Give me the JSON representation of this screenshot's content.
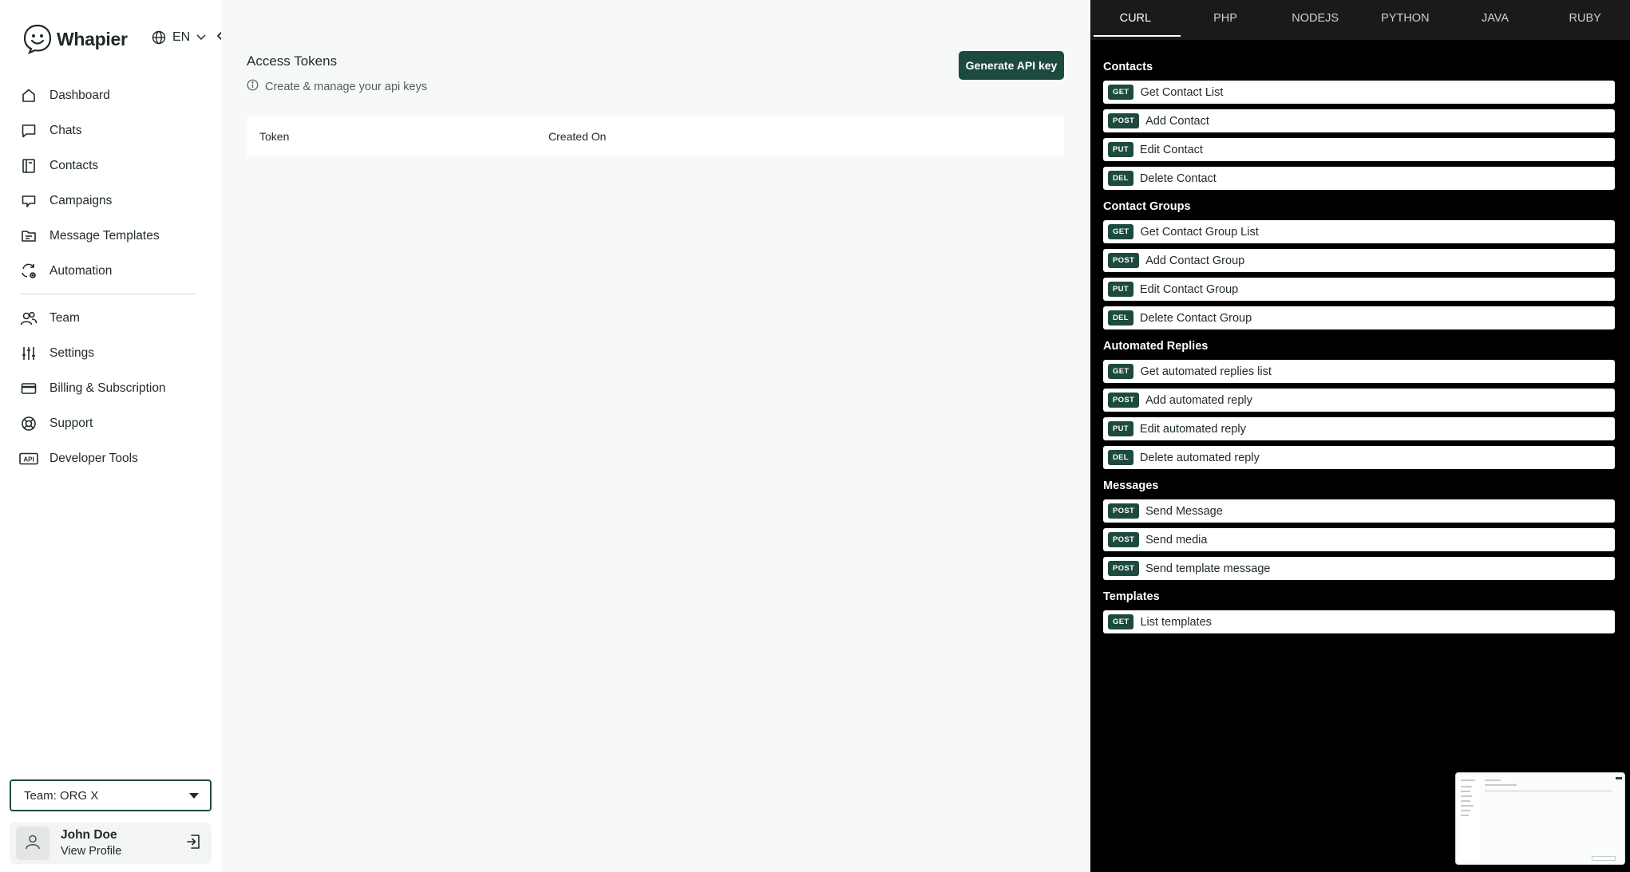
{
  "app": {
    "brand": "Whapier",
    "language": "EN"
  },
  "sidebar": {
    "items": [
      {
        "label": "Dashboard",
        "icon": "home-icon"
      },
      {
        "label": "Chats",
        "icon": "chat-bubble-icon"
      },
      {
        "label": "Contacts",
        "icon": "contacts-book-icon"
      },
      {
        "label": "Campaigns",
        "icon": "megaphone-icon"
      },
      {
        "label": "Message Templates",
        "icon": "folder-template-icon"
      },
      {
        "label": "Automation",
        "icon": "automation-icon"
      },
      {
        "label": "Team",
        "icon": "team-icon"
      },
      {
        "label": "Settings",
        "icon": "sliders-icon"
      },
      {
        "label": "Billing & Subscription",
        "icon": "credit-card-icon"
      },
      {
        "label": "Support",
        "icon": "lifebuoy-icon"
      },
      {
        "label": "Developer Tools",
        "icon": "api-icon"
      }
    ],
    "team_select": "Team: ORG X",
    "profile": {
      "name": "John Doe",
      "link": "View Profile"
    }
  },
  "main": {
    "title": "Access Tokens",
    "subtitle": "Create & manage your api keys",
    "generate_button": "Generate API key",
    "table": {
      "columns": [
        "Token",
        "Created On"
      ]
    }
  },
  "api_panel": {
    "tabs": [
      "CURL",
      "PHP",
      "NODEJS",
      "PYTHON",
      "JAVA",
      "RUBY"
    ],
    "active_tab": "CURL",
    "groups": [
      {
        "title": "Contacts",
        "endpoints": [
          {
            "method": "GET",
            "label": "Get Contact List"
          },
          {
            "method": "POST",
            "label": "Add Contact"
          },
          {
            "method": "PUT",
            "label": "Edit Contact"
          },
          {
            "method": "DEL",
            "label": "Delete Contact"
          }
        ]
      },
      {
        "title": "Contact Groups",
        "endpoints": [
          {
            "method": "GET",
            "label": "Get Contact Group List"
          },
          {
            "method": "POST",
            "label": "Add Contact Group"
          },
          {
            "method": "PUT",
            "label": "Edit Contact Group"
          },
          {
            "method": "DEL",
            "label": "Delete Contact Group"
          }
        ]
      },
      {
        "title": "Automated Replies",
        "endpoints": [
          {
            "method": "GET",
            "label": "Get automated replies list"
          },
          {
            "method": "POST",
            "label": "Add automated reply"
          },
          {
            "method": "PUT",
            "label": "Edit automated reply"
          },
          {
            "method": "DEL",
            "label": "Delete automated reply"
          }
        ]
      },
      {
        "title": "Messages",
        "endpoints": [
          {
            "method": "POST",
            "label": "Send Message"
          },
          {
            "method": "POST",
            "label": "Send media"
          },
          {
            "method": "POST",
            "label": "Send template message"
          }
        ]
      },
      {
        "title": "Templates",
        "endpoints": [
          {
            "method": "GET",
            "label": "List templates"
          }
        ]
      }
    ]
  },
  "colors": {
    "accent": "#1d4a3e",
    "panel_bg": "#000000",
    "tabs_bg": "#1a1a1a"
  }
}
